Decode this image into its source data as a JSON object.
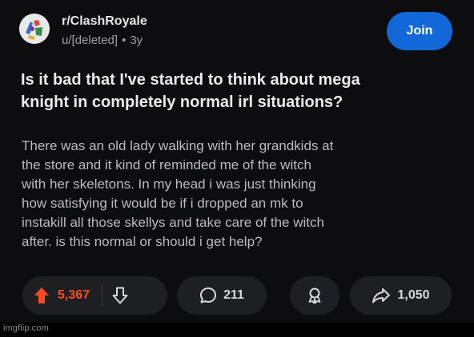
{
  "header": {
    "subreddit": "r/ClashRoyale",
    "author": "u/[deleted]",
    "separator": "•",
    "age": "3y",
    "join_label": "Join",
    "avatar_icon": "subreddit-avatar-icon"
  },
  "post": {
    "title_lines": [
      "Is it bad that I've started to think about mega",
      "knight in completely normal irl situations?"
    ],
    "body_lines": [
      "There was an old lady walking with her grandkids at",
      "the store and it kind of reminded me of the witch",
      "with her skeletons. In my head i was just thinking",
      "how satisfying it would be if i dropped an mk to",
      "instakill all those skellys and take care of the witch",
      "after. is this normal or should i get help?"
    ]
  },
  "actions": {
    "upvotes": "5,367",
    "comments": "211",
    "shares": "1,050",
    "upvote_icon": "upvote-arrow-icon",
    "downvote_icon": "downvote-arrow-icon",
    "comment_icon": "comment-bubble-icon",
    "award_icon": "award-icon",
    "share_icon": "share-arrow-icon"
  },
  "colors": {
    "background": "#0d0d0f",
    "join_button": "#1268d8",
    "upvote_active": "#ff4b1f",
    "pill_bg": "#1e1f22"
  },
  "watermark": "imgflip.com"
}
